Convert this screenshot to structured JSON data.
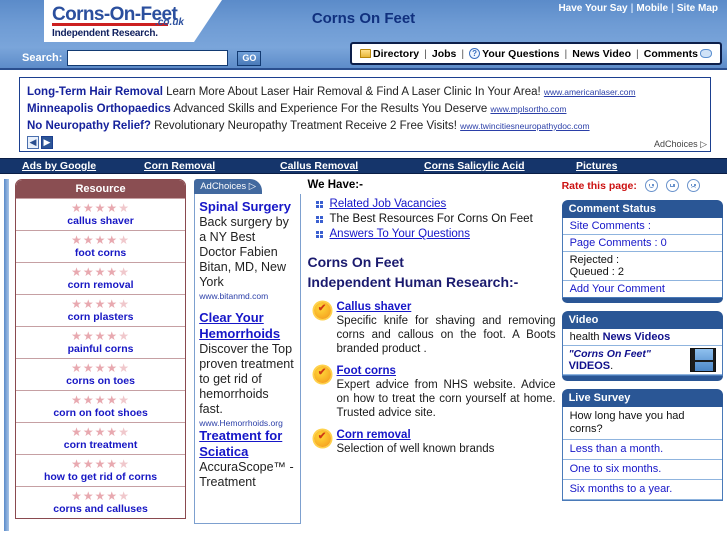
{
  "header": {
    "logo_main": "Corns-On-Feet",
    "logo_tld": ".co.uk",
    "logo_sub": "Independent Research.",
    "title": "Corns On Feet",
    "top_links": [
      "Have Your Say",
      "Mobile",
      "Site Map"
    ],
    "search_label": "Search:",
    "search_value": "",
    "search_placeholder": "",
    "go_label": "GO",
    "nav": [
      "Directory",
      "Jobs",
      "Your Questions",
      "News Video",
      "Comments"
    ]
  },
  "ads": {
    "lines": [
      {
        "bold": "Long-Term Hair Removal",
        "text": "Learn More About Laser Hair Removal & Find A Laser Clinic In Your Area!",
        "url": "www.americanlaser.com"
      },
      {
        "bold": "Minneapolis Orthopaedics",
        "text": "Advanced Skills and Experience For the Results You Deserve",
        "url": "www.mplsortho.com"
      },
      {
        "bold": "No Neuropathy Relief?",
        "text": "Revolutionary Neuropathy Treatment Receive 2 Free Visits!",
        "url": "www.twincitiesneuropathydoc.com"
      }
    ],
    "prev": "◀",
    "next": "▶",
    "adchoices": "AdChoices ▷"
  },
  "tabs": [
    {
      "label": "Ads by Google"
    },
    {
      "label": "Corn Removal"
    },
    {
      "label": "Callus Removal"
    },
    {
      "label": "Corns Salicylic Acid"
    },
    {
      "label": "Pictures"
    }
  ],
  "resource": {
    "title": "Resource",
    "items": [
      {
        "label": "callus shaver",
        "rating": 4.5
      },
      {
        "label": "foot corns",
        "rating": 4.5
      },
      {
        "label": "corn removal",
        "rating": 4.5
      },
      {
        "label": "corn plasters",
        "rating": 4.5
      },
      {
        "label": "painful corns",
        "rating": 4.5
      },
      {
        "label": "corns on toes",
        "rating": 4.5
      },
      {
        "label": "corn on foot shoes",
        "rating": 4.5
      },
      {
        "label": "corn treatment",
        "rating": 4.5
      },
      {
        "label": "how to get rid of corns",
        "rating": 4.5
      },
      {
        "label": "corns and calluses",
        "rating": 4.5
      }
    ]
  },
  "adcolumn": {
    "adchoices": "AdChoices ▷",
    "ads": [
      {
        "title": "Spinal Surgery",
        "underline": false,
        "body": "Back surgery by a NY Best Doctor Fabien Bitan, MD, New York",
        "site": "www.bitanmd.com"
      },
      {
        "title": "Clear Your Hemorrhoids",
        "underline": true,
        "body": "Discover the Top proven treatment to get rid of hemorrhoids fast.",
        "site": "www.Hemorrhoids.org"
      },
      {
        "title": "Treatment for Sciatica",
        "underline": true,
        "body": "AccuraScope™ - Treatment",
        "site": ""
      }
    ]
  },
  "main": {
    "we_have": "We Have:-",
    "have_items": [
      {
        "text": "Related Job Vacancies",
        "link": true
      },
      {
        "text": "The Best Resources For Corns On Feet",
        "link": false
      },
      {
        "text": "Answers To Your Questions",
        "link": true
      }
    ],
    "heading_line1": "Corns On Feet",
    "heading_line2": "Independent Human Research:-",
    "entries": [
      {
        "title": "Callus shaver",
        "text": "Specific knife for shaving and removing corns and callous on the foot. A Boots branded product ."
      },
      {
        "title": "Foot corns",
        "text": "Expert advice from NHS website. Advice on how to treat the corn yourself at home. Trusted advice site."
      },
      {
        "title": "Corn removal",
        "text": "Selection of well known brands"
      }
    ]
  },
  "right": {
    "rate_label": "Rate this page:",
    "comment_status": {
      "title": "Comment Status",
      "site_comments": "Site Comments :",
      "page_comments": "Page Comments : 0",
      "rejected": "Rejected :",
      "queued": "Queued : 2",
      "add_comment": "Add Your Comment"
    },
    "video": {
      "title": "Video",
      "line1_plain": "health ",
      "line1_bold": "News Videos",
      "quote": "\"Corns On Feet\"",
      "videos_word": "VIDEOS",
      "videos_period": "."
    },
    "survey": {
      "title": "Live Survey",
      "question": "How long have you had corns?",
      "options": [
        "Less than a month.",
        "One to six months.",
        "Six months to a year."
      ]
    }
  },
  "colors": {
    "header_blue": "#6e9bd4",
    "navy": "#15356b",
    "link_blue": "#1616c8",
    "maroon": "#8a4e52",
    "panel_blue": "#2a5695",
    "red": "#cc1111"
  }
}
